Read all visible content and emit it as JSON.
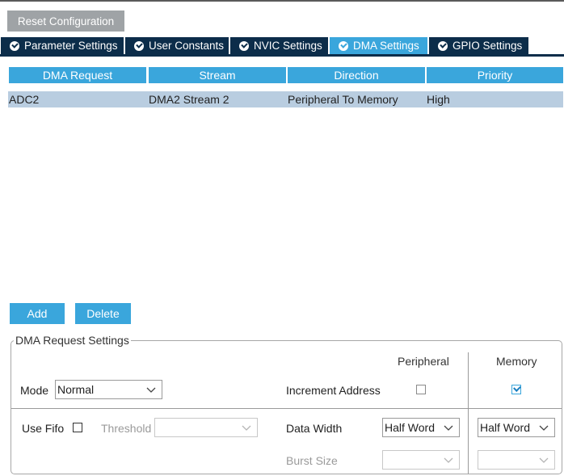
{
  "toolbar": {
    "reset_label": "Reset Configuration"
  },
  "tabs": [
    {
      "label": "Parameter Settings",
      "active": false
    },
    {
      "label": "User Constants",
      "active": false
    },
    {
      "label": "NVIC Settings",
      "active": false
    },
    {
      "label": "DMA Settings",
      "active": true
    },
    {
      "label": "GPIO Settings",
      "active": false
    }
  ],
  "table": {
    "columns": [
      "DMA Request",
      "Stream",
      "Direction",
      "Priority"
    ],
    "rows": [
      [
        "ADC2",
        "DMA2 Stream 2",
        "Peripheral To Memory",
        "High"
      ]
    ]
  },
  "actions": {
    "add_label": "Add",
    "delete_label": "Delete"
  },
  "settings": {
    "title": "DMA Request Settings",
    "peripheral_header": "Peripheral",
    "memory_header": "Memory",
    "mode_label": "Mode",
    "mode_value": "Normal",
    "increment_address_label": "Increment Address",
    "increment_peripheral_checked": false,
    "increment_memory_checked": true,
    "use_fifo_label": "Use Fifo",
    "use_fifo_checked": false,
    "threshold_label": "Threshold",
    "threshold_value": "",
    "data_width_label": "Data Width",
    "data_width_peripheral": "Half Word",
    "data_width_memory": "Half Word",
    "burst_size_label": "Burst Size",
    "burst_peripheral": "",
    "burst_memory": ""
  },
  "colors": {
    "tab_dark": "#0c2d4a",
    "accent": "#3aa6dc",
    "row_selected": "#b9cde0",
    "button_gray": "#9fa3a6"
  }
}
